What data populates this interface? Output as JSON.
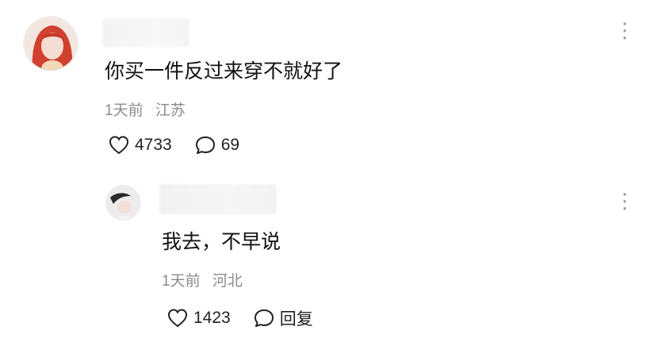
{
  "comment": {
    "text": "你买一件反过来穿不就好了",
    "time": "1天前",
    "location": "江苏",
    "likes": "4733",
    "replies": "69",
    "more_icon": "more-dots-icon"
  },
  "reply": {
    "text": "我去，不早说",
    "time": "1天前",
    "location": "河北",
    "likes": "1423",
    "reply_label": "回复",
    "more_icon": "more-dots-icon"
  },
  "colors": {
    "meta": "#8c8c8c",
    "text": "#111111",
    "icon": "#222222"
  }
}
